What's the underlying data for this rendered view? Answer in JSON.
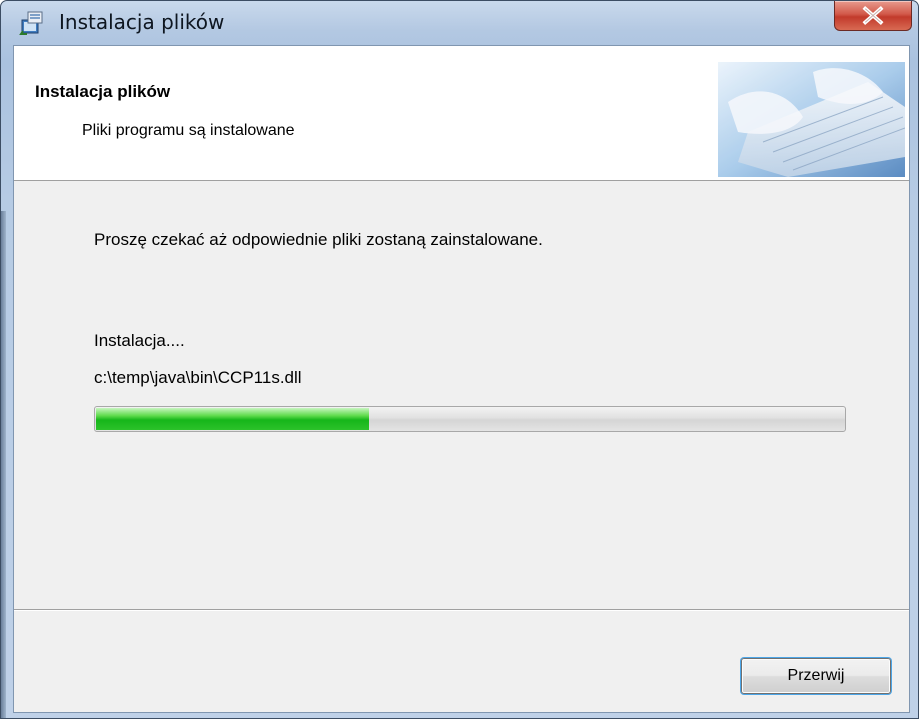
{
  "window": {
    "title": "Instalacja plików",
    "title_icon": "installer-icon",
    "close_icon": "close-icon"
  },
  "banner": {
    "title": "Instalacja plików",
    "subtitle": "Pliki programu są instalowane",
    "image": "keyboard-hands-image"
  },
  "body": {
    "message": "Proszę czekać aż odpowiednie pliki zostaną zainstalowane.",
    "status": "Instalacja....",
    "current_file": "c:\\temp\\java\\bin\\CCP11s.dll",
    "progress_fraction": 0.365
  },
  "buttons": {
    "cancel_label": "Przerwij"
  },
  "colors": {
    "progress_green": "#16b61a",
    "close_red": "#c23a2b"
  }
}
